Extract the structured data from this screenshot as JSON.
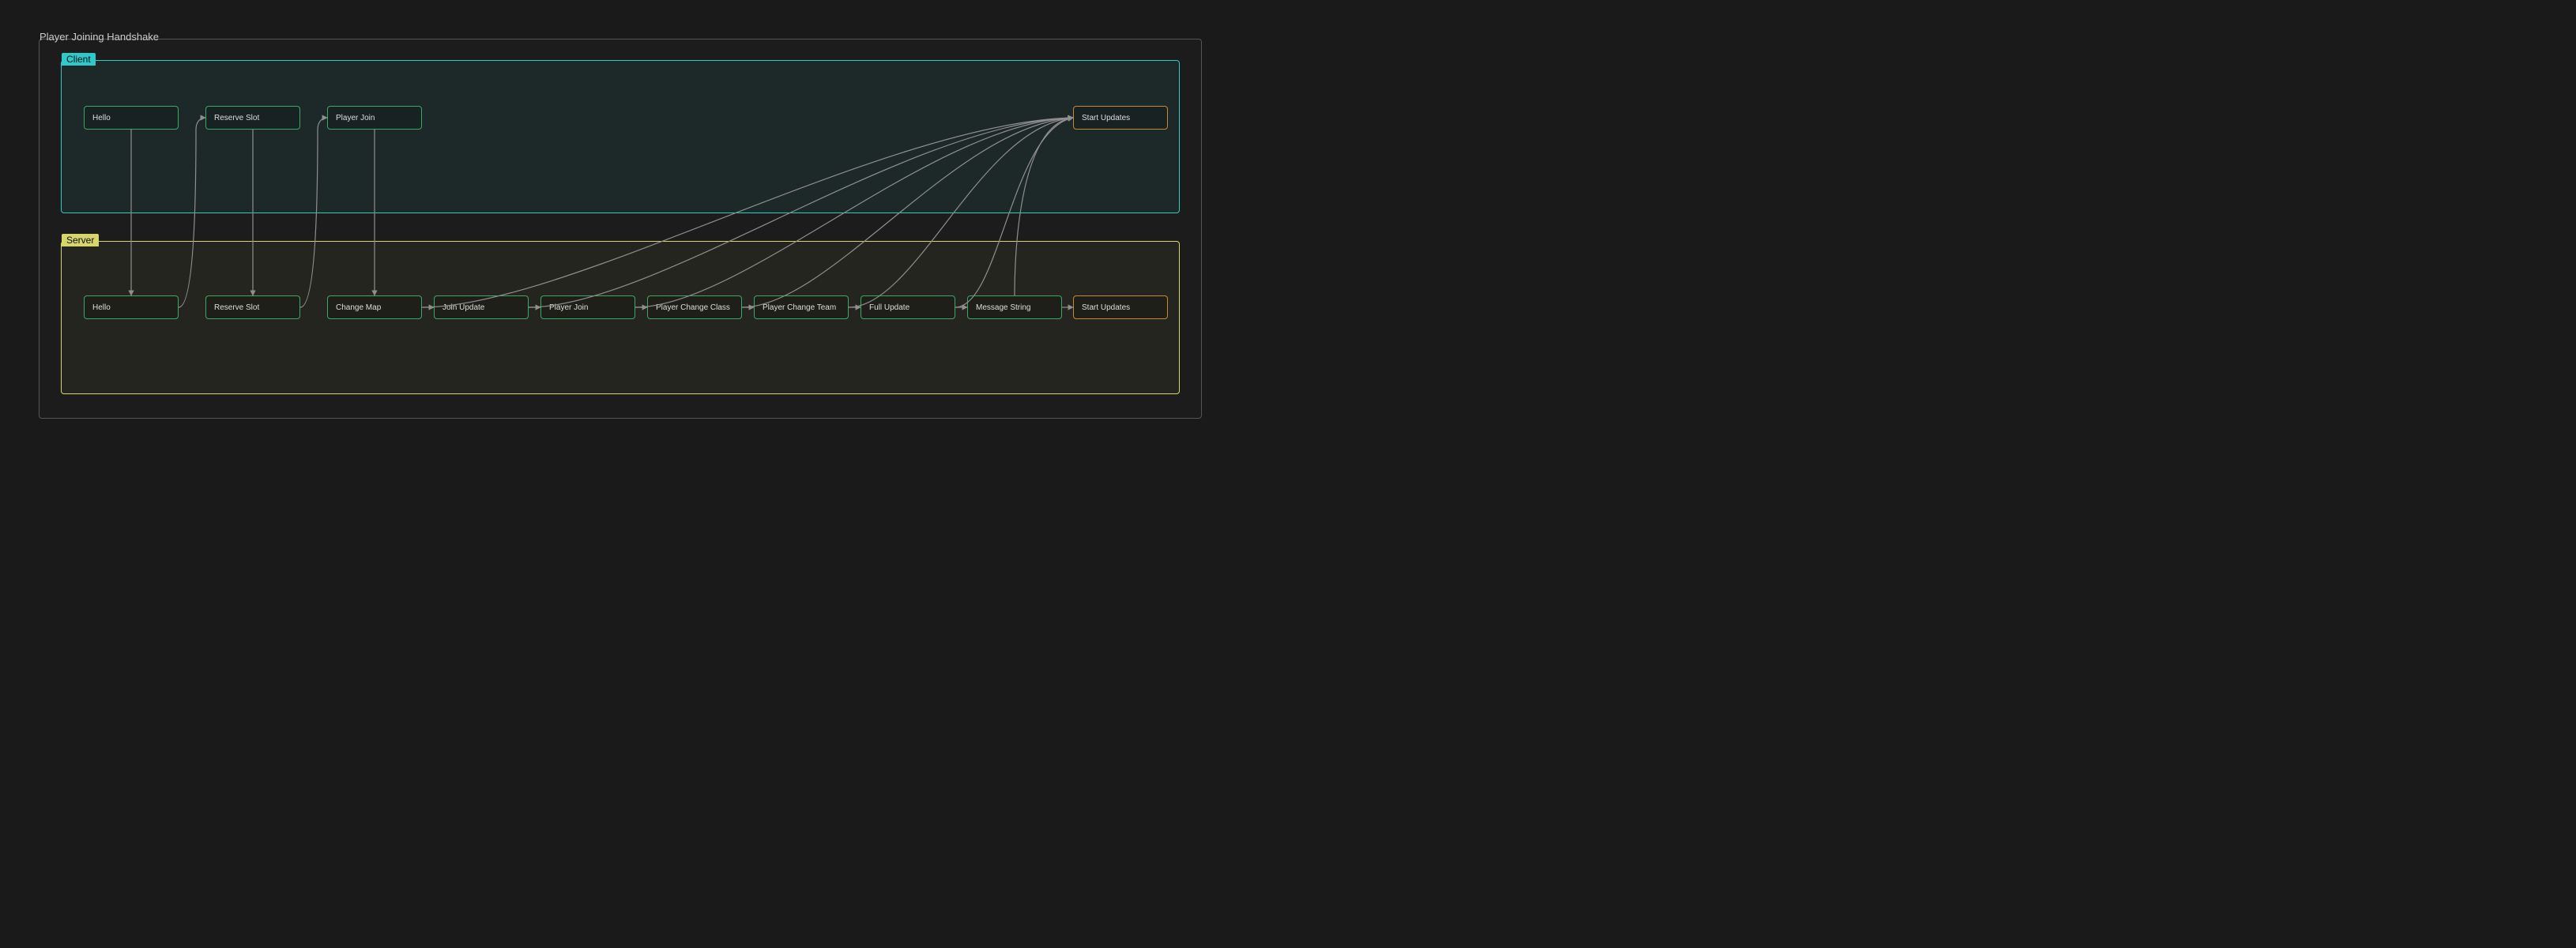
{
  "title": "Player Joining Handshake",
  "groups": {
    "client": {
      "label": "Client"
    },
    "server": {
      "label": "Server"
    }
  },
  "nodes": {
    "c_hello": {
      "label": "Hello"
    },
    "c_reserve": {
      "label": "Reserve Slot"
    },
    "c_playerjoin": {
      "label": "Player Join"
    },
    "c_startupdates": {
      "label": "Start Updates"
    },
    "s_hello": {
      "label": "Hello"
    },
    "s_reserve": {
      "label": "Reserve Slot"
    },
    "s_changemap": {
      "label": "Change Map"
    },
    "s_joinupdate": {
      "label": "Join Update"
    },
    "s_playerjoin": {
      "label": "Player Join"
    },
    "s_changeclass": {
      "label": "Player Change Class"
    },
    "s_changeteam": {
      "label": "Player Change Team"
    },
    "s_fullupdate": {
      "label": "Full Update"
    },
    "s_messagestring": {
      "label": "Message String"
    },
    "s_startupdates": {
      "label": "Start Updates"
    }
  },
  "colors": {
    "bg": "#1a1a1a",
    "client_border": "#2ec9c9",
    "server_border": "#d6d66b",
    "node_green": "#3da864",
    "node_orange": "#c58a2d",
    "edge": "#8f8f8f"
  },
  "layout_note": "Sequence/flow diagram showing message handshake between Client (top lane) and Server (bottom lane). Green nodes are regular steps, orange is terminal Start Updates."
}
